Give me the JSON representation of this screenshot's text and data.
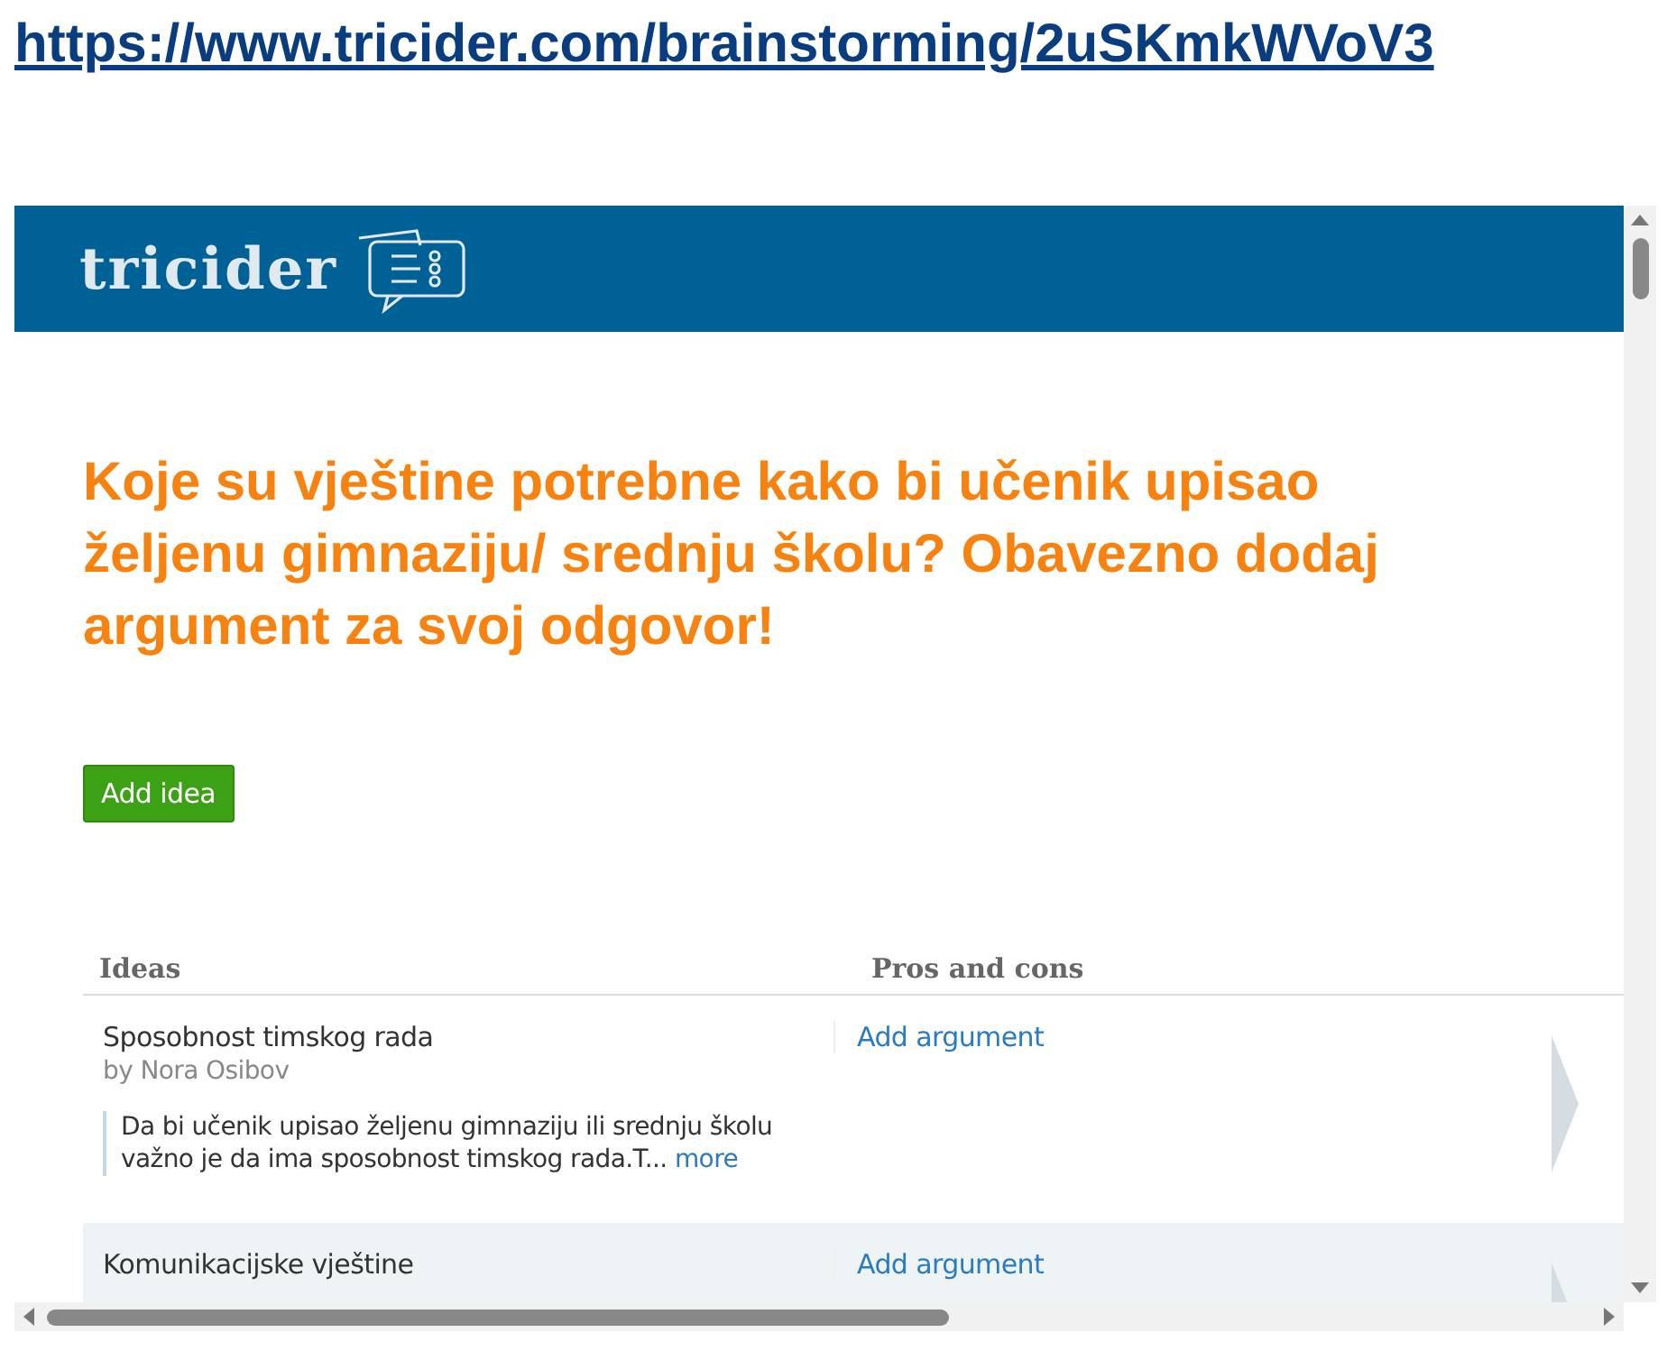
{
  "link": {
    "text": "https://www.tricider.com/brainstorming/2uSKmkWVoV3"
  },
  "header": {
    "logo": "tricider"
  },
  "question": "Koje su vještine potrebne kako bi učenik upisao željenu gimnaziju/ srednju školu? Obavezno dodaj argument za svoj odgovor!",
  "add_button": "Add idea",
  "table": {
    "columns": [
      "Ideas",
      "Pros and cons"
    ],
    "rows": [
      {
        "title": "Sposobnost timskog rada",
        "author": "by Nora Osibov",
        "description": "Da bi učenik upisao željenu gimnaziju ili srednju školu važno je da ima sposobnost timskog rada.T...",
        "more": "more",
        "argument": "Add argument",
        "shaded": false
      },
      {
        "title": "Komunikacijske vještine",
        "argument": "Add argument",
        "shaded": true
      }
    ]
  }
}
